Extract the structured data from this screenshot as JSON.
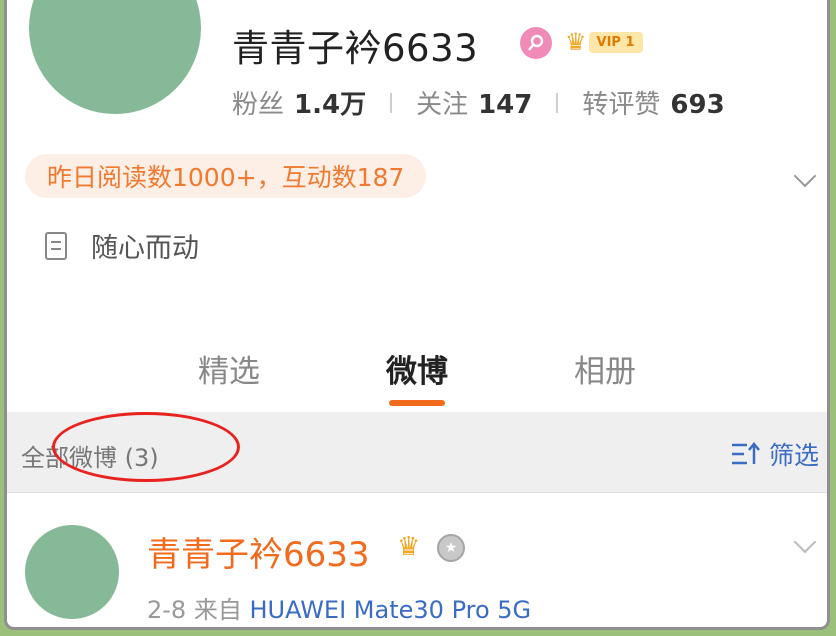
{
  "profile": {
    "name": "青青子衿6633",
    "vip_label": "VIP 1",
    "stats": [
      {
        "label": "粉丝",
        "value": "1.4万"
      },
      {
        "label": "关注",
        "value": "147"
      },
      {
        "label": "转评赞",
        "value": "693"
      }
    ],
    "highlight": "昨日阅读数1000+，互动数187",
    "bio": "随心而动"
  },
  "tabs": [
    {
      "label": "精选",
      "active": false
    },
    {
      "label": "微博",
      "active": true
    },
    {
      "label": "相册",
      "active": false
    }
  ],
  "feed": {
    "all_posts_label": "全部微博 (3)",
    "filter_label": "筛选"
  },
  "post": {
    "author": "青青子衿6633",
    "date": "2-8",
    "source_prefix": "来自",
    "device": "HUAWEI Mate30 Pro 5G"
  },
  "colors": {
    "accent_orange": "#f26b1d",
    "link_blue": "#3a6cc4",
    "annotation_red": "#e8231f",
    "avatar_green": "#86b997"
  }
}
